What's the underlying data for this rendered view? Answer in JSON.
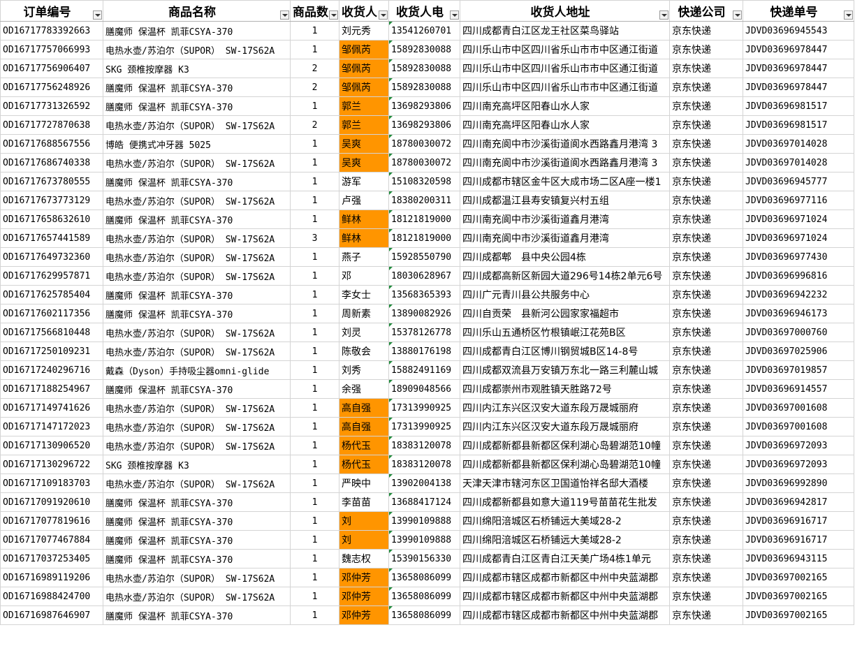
{
  "headers": [
    "订单编号",
    "商品名称",
    "商品数",
    "收货人",
    "收货人电",
    "收货人地址",
    "快递公司",
    "快递单号"
  ],
  "highlight_color": "#ff9500",
  "rows": [
    {
      "order": "OD16717783392663",
      "product": "膳魔师 保温杯 凯菲CSYA-370",
      "qty": "1",
      "name": "刘元秀",
      "phone": "13541260701",
      "addr": "四川成都青白江区龙王社区菜鸟驿站",
      "express": "京东快递",
      "track": "JDVD03696945543",
      "hl": false
    },
    {
      "order": "OD16717757066993",
      "product": "电热水壶/苏泊尔（SUPOR） SW-17S62A",
      "qty": "1",
      "name": "邹佩芮",
      "phone": " 15892830088",
      "addr": "四川乐山市中区四川省乐山市市中区通江街道",
      "express": "京东快递",
      "track": "JDVD03696978447",
      "hl": true
    },
    {
      "order": "OD16717756906407",
      "product": "SKG 颈椎按摩器 K3",
      "qty": "2",
      "name": "邹佩芮",
      "phone": " 15892830088",
      "addr": "四川乐山市中区四川省乐山市市中区通江街道",
      "express": "京东快递",
      "track": "JDVD03696978447",
      "hl": true
    },
    {
      "order": "OD16717756248926",
      "product": "膳魔师 保温杯 凯菲CSYA-370",
      "qty": "2",
      "name": "邹佩芮",
      "phone": " 15892830088",
      "addr": "四川乐山市中区四川省乐山市市中区通江街道",
      "express": "京东快递",
      "track": "JDVD03696978447",
      "hl": true
    },
    {
      "order": "OD16717731326592",
      "product": "膳魔师 保温杯 凯菲CSYA-370",
      "qty": "1",
      "name": "郭兰",
      "phone": "13698293806",
      "addr": "四川南充高坪区阳春山水人家",
      "express": "京东快递",
      "track": "JDVD03696981517",
      "hl": true
    },
    {
      "order": "OD16717727870638",
      "product": "电热水壶/苏泊尔（SUPOR） SW-17S62A",
      "qty": "2",
      "name": "郭兰",
      "phone": "13698293806",
      "addr": "四川南充高坪区阳春山水人家",
      "express": "京东快递",
      "track": "JDVD03696981517",
      "hl": true
    },
    {
      "order": "OD16717688567556",
      "product": "博皓 便携式冲牙器 5025",
      "qty": "1",
      "name": "吴爽",
      "phone": "18780030072",
      "addr": "四川南充阆中市沙溪街道阆水西路鑫月港湾 3",
      "express": "京东快递",
      "track": "JDVD03697014028",
      "hl": true
    },
    {
      "order": "OD16717686740338",
      "product": "电热水壶/苏泊尔（SUPOR） SW-17S62A",
      "qty": "1",
      "name": "吴爽",
      "phone": "18780030072",
      "addr": "四川南充阆中市沙溪街道阆水西路鑫月港湾 3",
      "express": "京东快递",
      "track": "JDVD03697014028",
      "hl": true
    },
    {
      "order": "OD16717673780555",
      "product": "膳魔师 保温杯 凯菲CSYA-370",
      "qty": "1",
      "name": "游军",
      "phone": "15108320598",
      "addr": "四川成都市辖区金牛区大成市场二区A座一楼1",
      "express": "京东快递",
      "track": "JDVD03696945777",
      "hl": false
    },
    {
      "order": "OD16717673773129",
      "product": "电热水壶/苏泊尔（SUPOR） SW-17S62A",
      "qty": "1",
      "name": "卢强",
      "phone": "18380200311",
      "addr": "四川成都温江县寿安镇复兴村五组",
      "express": "京东快递",
      "track": "JDVD03696977116",
      "hl": false
    },
    {
      "order": "OD16717658632610",
      "product": "膳魔师 保温杯 凯菲CSYA-370",
      "qty": "1",
      "name": "鲜林",
      "phone": "18121819000",
      "addr": "四川南充阆中市沙溪街道鑫月港湾",
      "express": "京东快递",
      "track": "JDVD03696971024",
      "hl": true
    },
    {
      "order": "OD16717657441589",
      "product": "电热水壶/苏泊尔（SUPOR） SW-17S62A",
      "qty": "3",
      "name": "鲜林",
      "phone": "18121819000",
      "addr": "四川南充阆中市沙溪街道鑫月港湾",
      "express": "京东快递",
      "track": "JDVD03696971024",
      "hl": true
    },
    {
      "order": "OD16717649732360",
      "product": "电热水壶/苏泊尔（SUPOR） SW-17S62A",
      "qty": "1",
      "name": "燕子",
      "phone": "15928550790",
      "addr": "四川成都郫　县中央公园4栋",
      "express": "京东快递",
      "track": "JDVD03696977430",
      "hl": false
    },
    {
      "order": "OD16717629957871",
      "product": "电热水壶/苏泊尔（SUPOR） SW-17S62A",
      "qty": "1",
      "name": "邓",
      "phone": "18030628967",
      "addr": "四川成都高新区新园大道296号14栋2单元6号",
      "express": "京东快递",
      "track": "JDVD03696996816",
      "hl": false
    },
    {
      "order": "OD16717625785404",
      "product": "膳魔师 保温杯 凯菲CSYA-370",
      "qty": "1",
      "name": "李女士",
      "phone": "13568365393",
      "addr": "四川广元青川县公共服务中心",
      "express": "京东快递",
      "track": "JDVD03696942232",
      "hl": false
    },
    {
      "order": "OD16717602117356",
      "product": "膳魔师 保温杯 凯菲CSYA-370",
      "qty": "1",
      "name": "周新素",
      "phone": "13890082926",
      "addr": "四川自贡荣　县新河公园家家福超市",
      "express": "京东快递",
      "track": "JDVD03696946173",
      "hl": false
    },
    {
      "order": "OD16717566810448",
      "product": "电热水壶/苏泊尔（SUPOR） SW-17S62A",
      "qty": "1",
      "name": "刘灵",
      "phone": "15378126778",
      "addr": "四川乐山五通桥区竹根镇岷江花苑B区",
      "express": "京东快递",
      "track": "JDVD03697000760",
      "hl": false
    },
    {
      "order": "OD16717250109231",
      "product": "电热水壶/苏泊尔（SUPOR） SW-17S62A",
      "qty": "1",
      "name": "陈敬会",
      "phone": "13880176198",
      "addr": "四川成都青白江区博川钢贸城B区14-8号",
      "express": "京东快递",
      "track": "JDVD03697025906",
      "hl": false
    },
    {
      "order": "OD16717240296716",
      "product": "戴森（Dyson）手持吸尘器omni-glide",
      "qty": "1",
      "name": "刘秀",
      "phone": "15882491169",
      "addr": "四川成都双流县万安镇万东北一路三利麓山城",
      "express": "京东快递",
      "track": "JDVD03697019857",
      "hl": false
    },
    {
      "order": "OD16717188254967",
      "product": "膳魔师 保温杯 凯菲CSYA-370",
      "qty": "1",
      "name": "余强",
      "phone": "18909048566",
      "addr": "四川成都崇州市观胜镇天胜路72号",
      "express": "京东快递",
      "track": "JDVD03696914557",
      "hl": false
    },
    {
      "order": "OD16717149741626",
      "product": "电热水壶/苏泊尔（SUPOR） SW-17S62A",
      "qty": "1",
      "name": "高自强",
      "phone": "17313990925",
      "addr": "四川内江东兴区汉安大道东段万晟城丽府",
      "express": "京东快递",
      "track": "JDVD03697001608",
      "hl": true
    },
    {
      "order": "OD16717147172023",
      "product": "电热水壶/苏泊尔（SUPOR） SW-17S62A",
      "qty": "1",
      "name": "高自强",
      "phone": "17313990925",
      "addr": "四川内江东兴区汉安大道东段万晟城丽府",
      "express": "京东快递",
      "track": "JDVD03697001608",
      "hl": true
    },
    {
      "order": "OD16717130906520",
      "product": "电热水壶/苏泊尔（SUPOR） SW-17S62A",
      "qty": "1",
      "name": "杨代玉",
      "phone": "18383120078",
      "addr": "四川成都新都县新都区保利湖心岛碧湖范10幢",
      "express": "京东快递",
      "track": "JDVD03696972093",
      "hl": true
    },
    {
      "order": "OD16717130296722",
      "product": "SKG 颈椎按摩器 K3",
      "qty": "1",
      "name": "杨代玉",
      "phone": "18383120078",
      "addr": "四川成都新都县新都区保利湖心岛碧湖范10幢",
      "express": "京东快递",
      "track": "JDVD03696972093",
      "hl": true
    },
    {
      "order": "OD16717109183703",
      "product": "电热水壶/苏泊尔（SUPOR） SW-17S62A",
      "qty": "1",
      "name": "严映中",
      "phone": "13902004138",
      "addr": "天津天津市辖河东区卫国道怡祥名邸大酒楼",
      "express": "京东快递",
      "track": "JDVD03696992890",
      "hl": false
    },
    {
      "order": "OD16717091920610",
      "product": "膳魔师 保温杯 凯菲CSYA-370",
      "qty": "1",
      "name": "李苗苗",
      "phone": "13688417124",
      "addr": "四川成都新都县如意大道119号苗苗花生批发",
      "express": "京东快递",
      "track": "JDVD03696942817",
      "hl": false
    },
    {
      "order": "OD16717077819616",
      "product": "膳魔师 保温杯 凯菲CSYA-370",
      "qty": "1",
      "name": "刘",
      "phone": "13990109888",
      "addr": "四川绵阳涪城区石桥铺远大美域28-2",
      "express": "京东快递",
      "track": "JDVD03696916717",
      "hl": true
    },
    {
      "order": "OD16717077467884",
      "product": "膳魔师 保温杯 凯菲CSYA-370",
      "qty": "1",
      "name": "刘",
      "phone": "13990109888",
      "addr": "四川绵阳涪城区石桥铺远大美域28-2",
      "express": "京东快递",
      "track": "JDVD03696916717",
      "hl": true
    },
    {
      "order": "OD16717037253405",
      "product": "膳魔师 保温杯 凯菲CSYA-370",
      "qty": "1",
      "name": "魏志权",
      "phone": "15390156330",
      "addr": "四川成都青白江区青白江天美广场4栋1单元",
      "express": "京东快递",
      "track": "JDVD03696943115",
      "hl": false
    },
    {
      "order": "OD16716989119206",
      "product": "电热水壶/苏泊尔（SUPOR） SW-17S62A",
      "qty": "1",
      "name": "邓仲芳",
      "phone": "13658086099",
      "addr": "四川成都市辖区成都市新都区中州中央蓝湖郡",
      "express": "京东快递",
      "track": "JDVD03697002165",
      "hl": true
    },
    {
      "order": "OD16716988424700",
      "product": "电热水壶/苏泊尔（SUPOR） SW-17S62A",
      "qty": "1",
      "name": "邓仲芳",
      "phone": "13658086099",
      "addr": "四川成都市辖区成都市新都区中州中央蓝湖郡",
      "express": "京东快递",
      "track": "JDVD03697002165",
      "hl": true
    },
    {
      "order": "OD16716987646907",
      "product": "膳魔师 保温杯 凯菲CSYA-370",
      "qty": "1",
      "name": "邓仲芳",
      "phone": "13658086099",
      "addr": "四川成都市辖区成都市新都区中州中央蓝湖郡",
      "express": "京东快递",
      "track": "JDVD03697002165",
      "hl": true
    }
  ]
}
